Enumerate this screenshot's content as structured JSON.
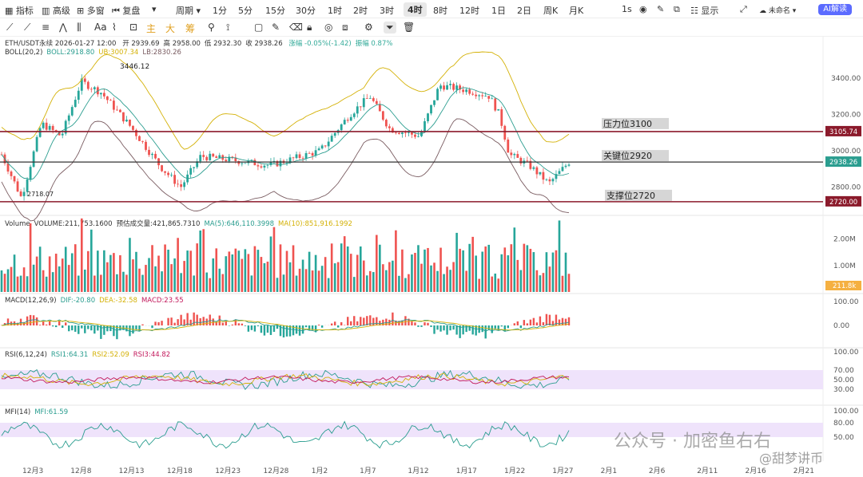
{
  "toolbar": {
    "indicators": "指标",
    "advanced": "高级",
    "multi": "多窗",
    "replay": "复盘",
    "period": "周期",
    "intervals": [
      "1分",
      "5分",
      "15分",
      "30分",
      "1时",
      "2时",
      "3时",
      "4时",
      "8时",
      "12时",
      "1日",
      "2日",
      "周K",
      "月K"
    ],
    "active_interval": "4时",
    "right_items": [
      "1s",
      "显示",
      "未命名"
    ],
    "ai_button": "AI解读"
  },
  "drawbar": {
    "tags": [
      "主",
      "大",
      "筹"
    ],
    "colors": [
      "#e0a020",
      "#e0a020",
      "#e0a020"
    ]
  },
  "price_panel": {
    "title": "ETH/USDT永续  2026-01-27 12:00",
    "ohlc": {
      "open": "开 2939.69",
      "high": "高 2958.00",
      "low": "低 2932.30",
      "close": "收 2938.26",
      "change": "涨幅 -0.05%(-1.42)",
      "amp": "振幅 0.87%"
    },
    "boll": {
      "name": "BOLL(20,2)",
      "boll": "BOLL:2918.80",
      "ub": "UB:3007.34",
      "lb": "LB:2830.26"
    },
    "high_label": "3446.12",
    "low_label": "2718.07",
    "levels": [
      {
        "label": "压力位3100",
        "tag": "3105.74",
        "price": 3105.74
      },
      {
        "label": "关键位2920",
        "tag": "2938.26",
        "price": 2938.26
      },
      {
        "label": "支撑位2720",
        "tag": "2720.00",
        "price": 2720
      }
    ]
  },
  "volume_panel": {
    "title": "Volume",
    "vol": "VOLUME:211,753.1600",
    "est": "预估成交量:421,865.7310",
    "ma5": "MA(5):646,110.3998",
    "ma10": "MA(10):851,916.1992",
    "current_tag": "211.8k"
  },
  "macd_panel": {
    "title": "MACD(12,26,9)",
    "dif": "DIF:-20.80",
    "dea": "DEA:-32.58",
    "macd": "MACD:23.55"
  },
  "rsi_panel": {
    "title": "RSI(6,12,24)",
    "rsi1": "RSI1:64.31",
    "rsi2": "RSI2:52.09",
    "rsi3": "RSI3:44.82"
  },
  "mfi_panel": {
    "title": "MFI(14)",
    "mfi": "MFI:61.59"
  },
  "x_axis_labels": [
    "12月3",
    "12月8",
    "12月13",
    "12月18",
    "12月23",
    "12月28",
    "1月2",
    "1月7",
    "1月12",
    "1月17",
    "1月22",
    "1月27",
    "2月1",
    "2月6",
    "2月11",
    "2月16",
    "2月21"
  ],
  "watermark": {
    "text1": "公众号 · 加密鱼右右",
    "text2": "@甜梦讲币"
  },
  "chart_data": [
    {
      "type": "candlestick",
      "title": "ETH/USDT永续",
      "y_ticks": [
        2800,
        3000,
        3200,
        3400
      ],
      "ylim": [
        2680,
        3500
      ],
      "close_path": [
        {
          "x": "12月1",
          "y": 2980
        },
        {
          "x": "12月3",
          "y": 2740
        },
        {
          "x": "12月5",
          "y": 3150
        },
        {
          "x": "12月7",
          "y": 3080
        },
        {
          "x": "12月9",
          "y": 3380
        },
        {
          "x": "12月11",
          "y": 3320
        },
        {
          "x": "12月14",
          "y": 3130
        },
        {
          "x": "12月17",
          "y": 2910
        },
        {
          "x": "12月19",
          "y": 2800
        },
        {
          "x": "12月21",
          "y": 2970
        },
        {
          "x": "12月24",
          "y": 2950
        },
        {
          "x": "12月28",
          "y": 2920
        },
        {
          "x": "1月2",
          "y": 3000
        },
        {
          "x": "1月5",
          "y": 3200
        },
        {
          "x": "1月7",
          "y": 3300
        },
        {
          "x": "1月9",
          "y": 3120
        },
        {
          "x": "1月12",
          "y": 3080
        },
        {
          "x": "1月14",
          "y": 3360
        },
        {
          "x": "1月17",
          "y": 3330
        },
        {
          "x": "1月19",
          "y": 3300
        },
        {
          "x": "1月20",
          "y": 3200
        },
        {
          "x": "1月21",
          "y": 2980
        },
        {
          "x": "1月23",
          "y": 2920
        },
        {
          "x": "1月25",
          "y": 2820
        },
        {
          "x": "1月27",
          "y": 2938
        }
      ],
      "horizontal_lines": [
        3105.74,
        2938.26,
        2720
      ]
    },
    {
      "type": "bar",
      "title": "Volume",
      "y_ticks_labels": [
        "2.00M",
        "1.00M"
      ]
    },
    {
      "type": "bar",
      "title": "MACD(12,26,9)",
      "y_ticks": [
        100,
        0
      ]
    },
    {
      "type": "line",
      "title": "RSI(6,12,24)",
      "y_ticks": [
        100,
        70,
        50,
        30
      ]
    },
    {
      "type": "line",
      "title": "MFI(14)",
      "y_ticks": [
        100,
        80,
        50
      ]
    }
  ]
}
